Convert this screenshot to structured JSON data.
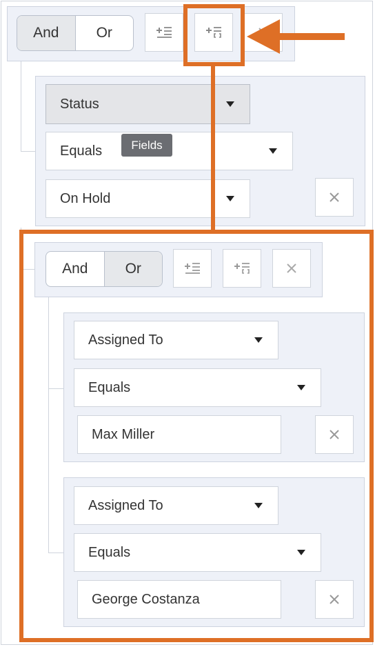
{
  "root_group": {
    "conjunction": {
      "and_label": "And",
      "or_label": "Or",
      "selected": "And"
    },
    "buttons": [
      "add-rule-icon",
      "add-group-icon",
      "close-icon"
    ]
  },
  "rule_1": {
    "field": "Status",
    "operator": "Equals",
    "value": "On Hold",
    "tooltip": "Fields"
  },
  "nested_group": {
    "conjunction": {
      "and_label": "And",
      "or_label": "Or",
      "selected": "Or"
    },
    "rules": [
      {
        "field": "Assigned To",
        "operator": "Equals",
        "value": "Max Miller"
      },
      {
        "field": "Assigned To",
        "operator": "Equals",
        "value": "George Costanza"
      }
    ]
  },
  "colors": {
    "highlight": "#de6f26",
    "panel": "#eef1f8",
    "border": "#cfd4dc"
  }
}
